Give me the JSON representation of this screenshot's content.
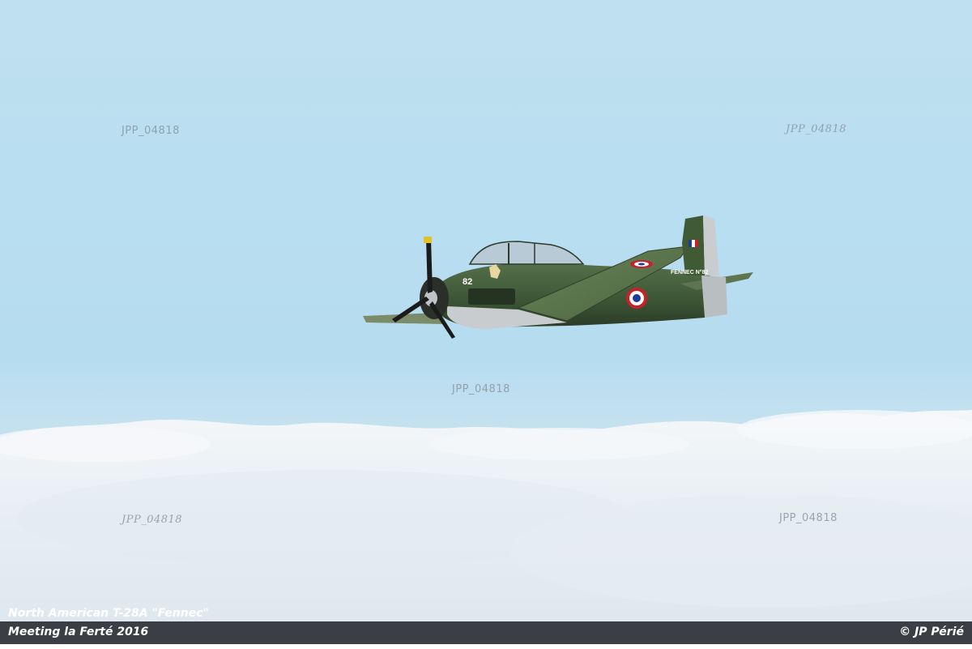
{
  "photo": {
    "subject": "plane-illustration",
    "colors": {
      "sky_top": "#bfe0f0",
      "airframe_green": "#3f5a35",
      "cloud": "#f2f5f7",
      "caption_bar": "#3b3f45"
    },
    "aircraft_markings": {
      "fuselage_number": "82",
      "tail_name": "FENNEC N°82"
    }
  },
  "watermarks": {
    "top_left": "JPP_04818",
    "top_right": "JPP_04818",
    "center": "JPP_04818",
    "bottom_left": "JPP_04818",
    "bottom_right": "JPP_04818"
  },
  "caption": {
    "aircraft_name": "North American T-28A \"Fennec\"",
    "event": "Meeting la Ferté 2016",
    "credit": "© JP Périé"
  }
}
